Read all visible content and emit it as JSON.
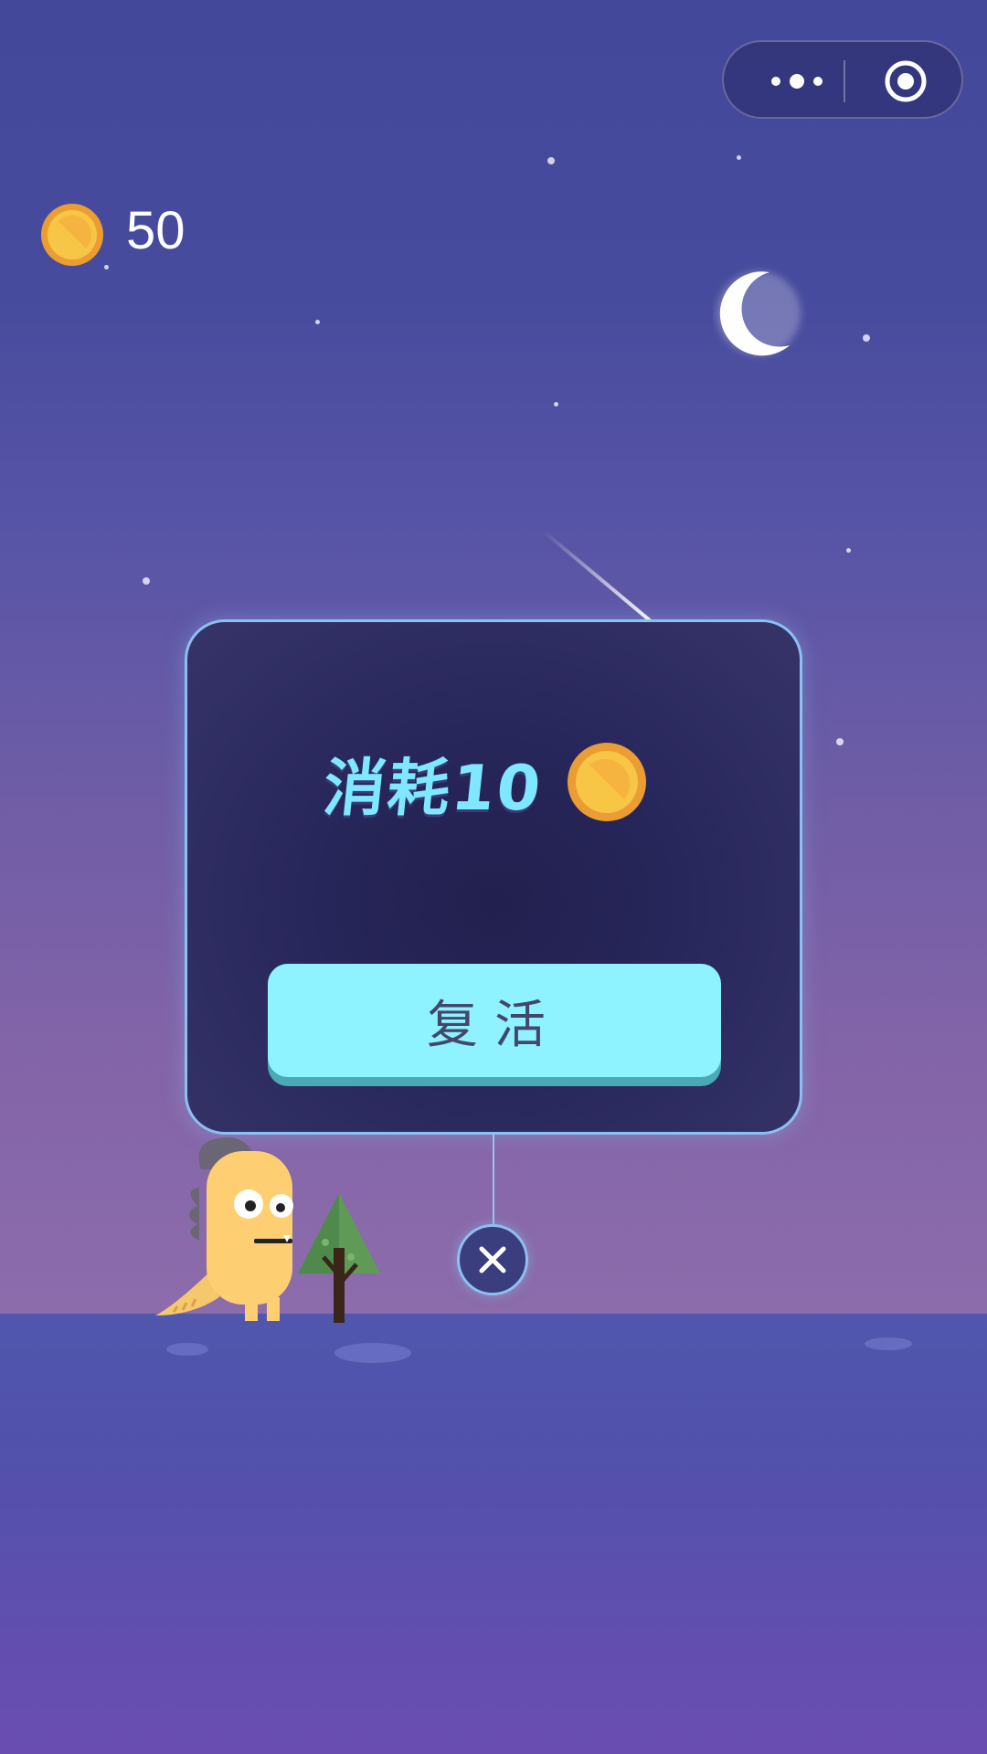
{
  "menu_bar": {
    "more_icon": "more-dots-icon",
    "close_icon": "target-icon"
  },
  "hud": {
    "coins": "50",
    "coin_icon": "coin-icon"
  },
  "dialog": {
    "cost_label": "消耗10",
    "cost_coin_icon": "coin-icon",
    "revive_label": "复活",
    "close_icon": "close-x-icon"
  },
  "scene": {
    "moon_icon": "crescent-moon-icon",
    "character": "yellow-dinosaur",
    "tree": "pine-tree"
  },
  "colors": {
    "revive_button": "#8ef2ff",
    "cost_text": "#7fe8ff",
    "coin": "#f7c646",
    "modal_border": "#8cc0f0"
  }
}
